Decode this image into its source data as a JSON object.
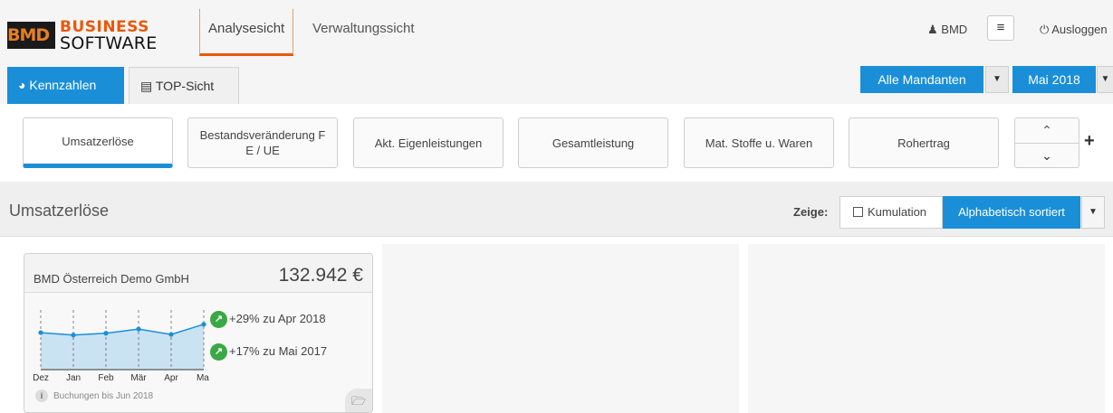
{
  "header": {
    "logo_top": "BUSINESS",
    "logo_bottom": "SOFTWARE",
    "logo_mark": "BMD",
    "nav_tabs": [
      {
        "label": "Analysesicht"
      },
      {
        "label": "Verwaltungssicht"
      }
    ],
    "user_icon": "user-icon",
    "user": "BMD",
    "menu_icon": "hamburger-icon",
    "logout_icon": "power-icon",
    "logout": "Ausloggen"
  },
  "tabs": [
    {
      "label": "Kennzahlen",
      "icon": "dashboard-icon"
    },
    {
      "label": "TOP-Sicht",
      "icon": "list-icon"
    }
  ],
  "filters": {
    "client": "Alle Mandanten",
    "period": "Mai 2018"
  },
  "kpis": [
    {
      "label": "Umsatzerlöse"
    },
    {
      "label": "Bestandsveränderung F E / UE"
    },
    {
      "label": "Akt. Eigenleistungen"
    },
    {
      "label": "Gesamtleistung"
    },
    {
      "label": "Mat. Stoffe u. Waren"
    },
    {
      "label": "Rohertrag"
    }
  ],
  "section": {
    "title": "Umsatzerlöse",
    "show_label": "Zeige:",
    "cumulation_label": "Kumulation",
    "sort_label": "Alphabetisch sortiert"
  },
  "card": {
    "company": "BMD Österreich Demo GmbH",
    "value": "132.942 €",
    "trends": [
      {
        "text": "+29% zu Apr 2018"
      },
      {
        "text": "+17% zu Mai 2017"
      }
    ],
    "footer": "Buchungen bis Jun 2018",
    "info_icon": "info-icon",
    "folder_icon": "folder-open-icon"
  },
  "chart_data": {
    "type": "area",
    "categories": [
      "Dez",
      "Jan",
      "Feb",
      "Mär",
      "Apr",
      "Mai"
    ],
    "values": [
      0.62,
      0.58,
      0.61,
      0.68,
      0.59,
      0.76
    ],
    "ylim": [
      0,
      1
    ],
    "color": "#1a8fd8"
  },
  "colors": {
    "accent": "#1a8fd8",
    "brand": "#e8590c",
    "positive": "#3aa845"
  }
}
